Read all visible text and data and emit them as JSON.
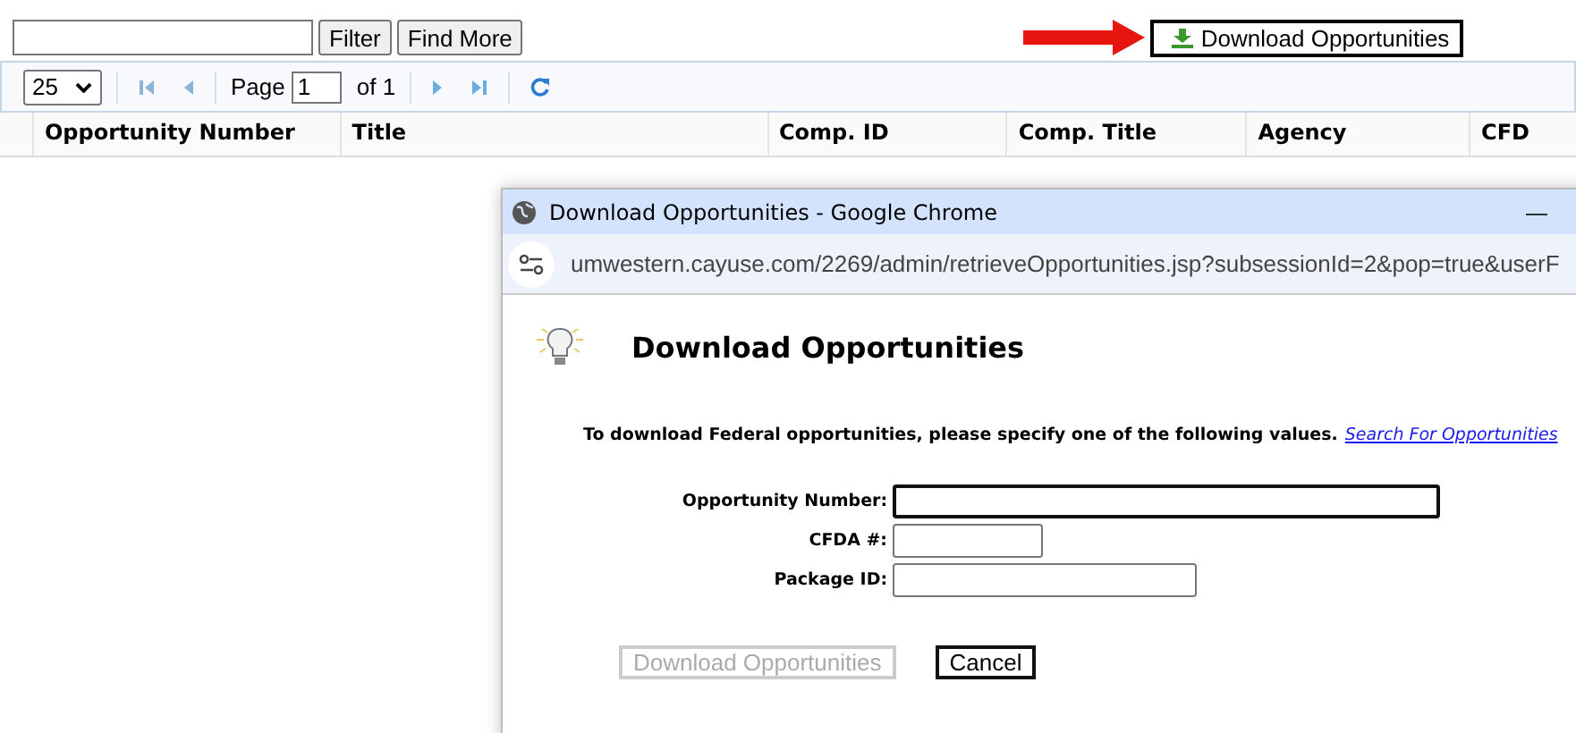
{
  "toolbar": {
    "filter_button": "Filter",
    "find_more_button": "Find More",
    "download_button": "Download Opportunities"
  },
  "pager": {
    "page_size": "25",
    "page_label": "Page",
    "page_value": "1",
    "of_label": "of 1"
  },
  "table": {
    "columns": [
      "Opportunity Number",
      "Title",
      "Comp. ID",
      "Comp. Title",
      "Agency",
      "CFD"
    ]
  },
  "popup": {
    "title": "Download Opportunities - Google Chrome",
    "minimize": "—",
    "url": "umwestern.cayuse.com/2269/admin/retrieveOpportunities.jsp?subsessionId=2&pop=true&userF",
    "heading": "Download Opportunities",
    "instruction": "To download Federal opportunities, please specify one of the following values.",
    "link": "Search For Opportunities",
    "fields": [
      {
        "label": "Opportunity Number:",
        "focused": true
      },
      {
        "label": "CFDA #:",
        "focused": false
      },
      {
        "label": "Package ID:",
        "focused": false
      }
    ],
    "buttons": [
      {
        "label": "Download Opportunities",
        "disabled": true
      },
      {
        "label": "Cancel",
        "disabled": false
      }
    ]
  }
}
